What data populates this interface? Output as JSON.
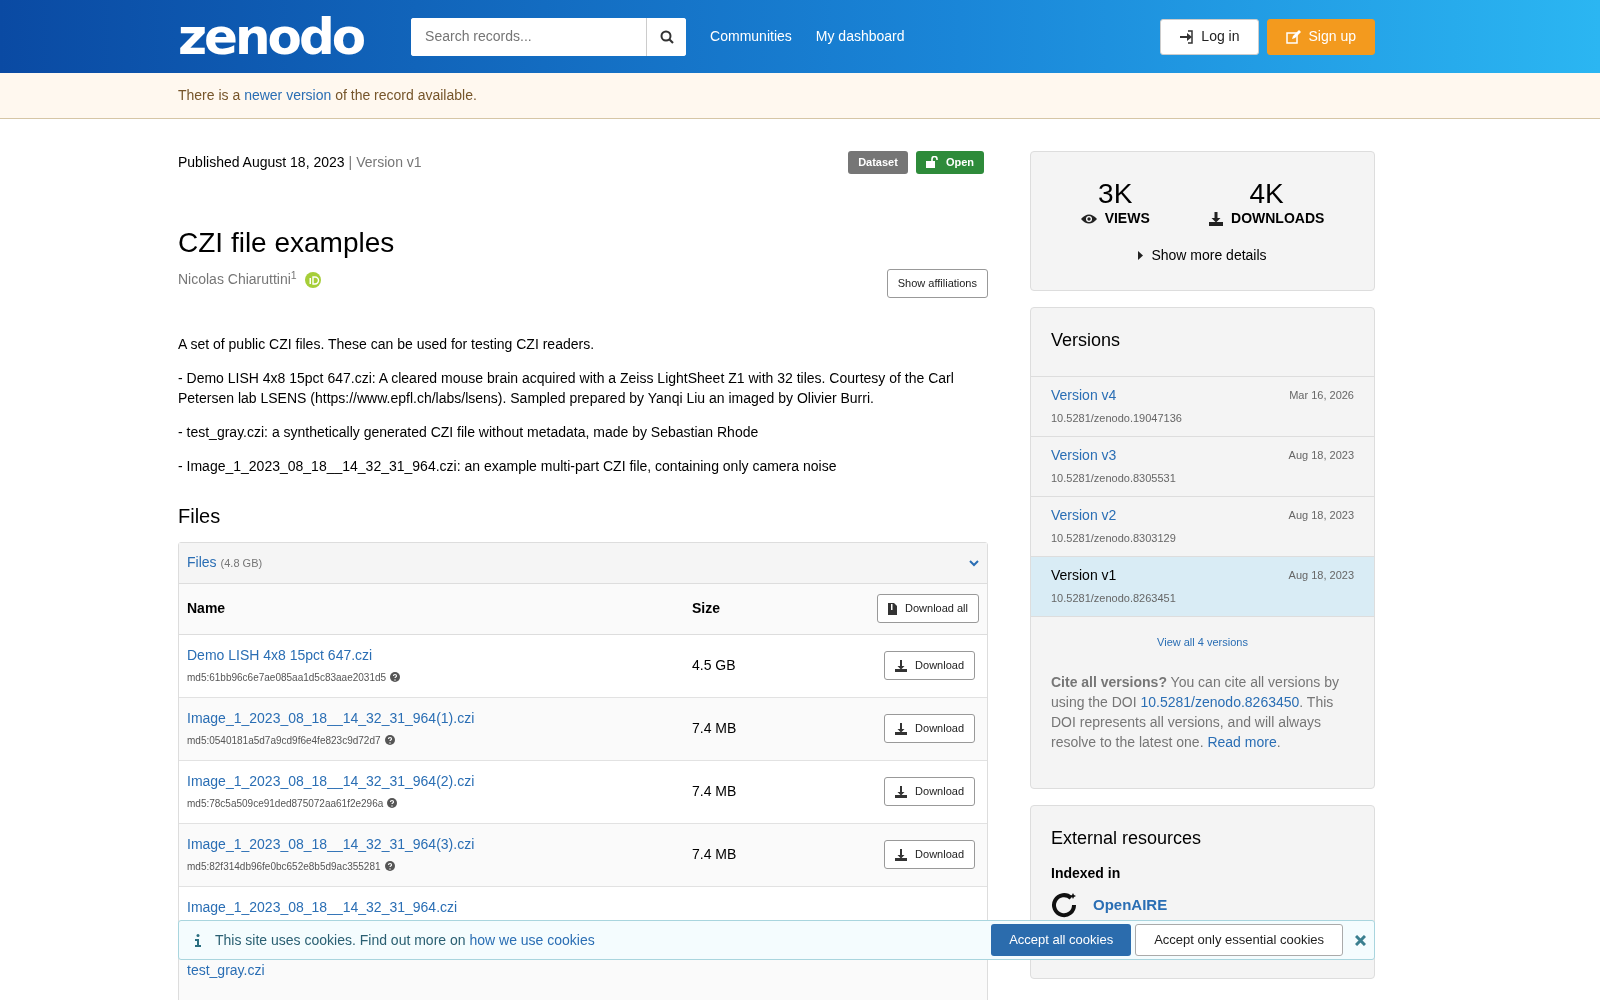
{
  "header": {
    "logo": "zenodo",
    "search": {
      "placeholder": "Search records..."
    },
    "nav": [
      "Communities",
      "My dashboard"
    ],
    "buttons": [
      {
        "label": "Log in",
        "kind": "login"
      },
      {
        "label": "Sign up",
        "kind": "signup"
      }
    ]
  },
  "notice": {
    "before": "There is a",
    "link": "newer version",
    "after": "of the record available."
  },
  "record": {
    "published": "Published August 18, 2023",
    "separator": "|",
    "version": "Version v1",
    "badges": [
      {
        "label": "Dataset",
        "kind": "type"
      },
      {
        "label": "Open",
        "kind": "access"
      }
    ],
    "title": "CZI file examples",
    "author": {
      "name": "Nicolas Chiaruttini",
      "mark": "1"
    },
    "affiliations_button": "Show affiliations",
    "description": [
      "A set of public CZI files. These can be used for testing CZI readers.",
      "- Demo LISH 4x8 15pct 647.czi: A cleared mouse brain acquired with a Zeiss LightSheet Z1 with 32 tiles. Courtesy of the Carl Petersen lab LSENS (https://www.epfl.ch/labs/lsens). Sampled prepared by Yanqi Liu an imaged by Olivier Burri.",
      "- test_gray.czi: a synthetically generated CZI file without metadata, made by Sebastian Rhode",
      "- Image_1_2023_08_18__14_32_31_964.czi: an example multi-part CZI file, containing only camera noise"
    ]
  },
  "files": {
    "heading": "Files",
    "panel_title": "Files",
    "total": "(4.8 GB)",
    "expanded": true,
    "columns": [
      "Name",
      "Size"
    ],
    "download_all": "Download all",
    "rows": [
      {
        "name": "Demo LISH 4x8 15pct 647.czi",
        "checksum": "md5:61bb96c6e7ae085aa1d5c83aae2031d5",
        "size": "4.5 GB",
        "button": "Download"
      },
      {
        "name": "Image_1_2023_08_18__14_32_31_964(1).czi",
        "checksum": "md5:0540181a5d7a9cd9f6e4fe823c9d72d7",
        "size": "7.4 MB",
        "button": "Download"
      },
      {
        "name": "Image_1_2023_08_18__14_32_31_964(2).czi",
        "checksum": "md5:78c5a509ce91ded875072aa61f2e296a",
        "size": "7.4 MB",
        "button": "Download"
      },
      {
        "name": "Image_1_2023_08_18__14_32_31_964(3).czi",
        "checksum": "md5:82f314db96fe0bc652e8b5d9ac355281",
        "size": "7.4 MB",
        "button": "Download"
      },
      {
        "name": "Image_1_2023_08_18__14_32_31_964.czi"
      },
      {
        "name": "test_gray.czi"
      }
    ]
  },
  "stats": {
    "items": [
      {
        "value": "3K",
        "label": "VIEWS",
        "kind": "views"
      },
      {
        "value": "4K",
        "label": "DOWNLOADS",
        "kind": "downloads"
      }
    ],
    "more": "Show more details"
  },
  "versions": {
    "heading": "Versions",
    "items": [
      {
        "label": "Version v4",
        "date": "Mar 16, 2026",
        "doi": "10.5281/zenodo.19047136",
        "selected": false
      },
      {
        "label": "Version v3",
        "date": "Aug 18, 2023",
        "doi": "10.5281/zenodo.8305531",
        "selected": false
      },
      {
        "label": "Version v2",
        "date": "Aug 18, 2023",
        "doi": "10.5281/zenodo.8303129",
        "selected": false
      },
      {
        "label": "Version v1",
        "date": "Aug 18, 2023",
        "doi": "10.5281/zenodo.8263451",
        "selected": true
      }
    ],
    "view_all": "View all 4 versions",
    "cite": {
      "lead": "Cite all versions?",
      "text": "You can cite all versions by using the DOI",
      "doi": "10.5281/zenodo.8263450",
      "rest": ". This DOI represents all versions, and will always resolve to the latest one.",
      "read_more": "Read more",
      "end": "."
    }
  },
  "external": {
    "heading": "External resources",
    "subheading": "Indexed in",
    "items": [
      "OpenAIRE"
    ]
  },
  "cookies": {
    "text": "This site uses cookies. Find out more on",
    "link": "how we use cookies",
    "accept_all": "Accept all cookies",
    "accept_essential": "Accept only essential cookies"
  }
}
